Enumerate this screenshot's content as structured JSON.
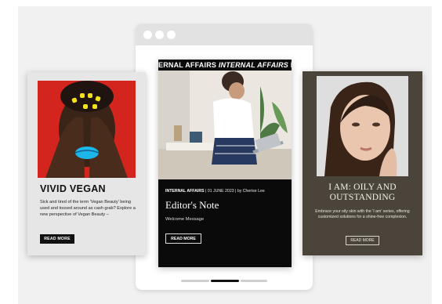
{
  "browser": {
    "window_dots": [
      "window-dot-1",
      "window-dot-2",
      "window-dot-3"
    ]
  },
  "cards": {
    "left": {
      "title": "VIVID VEGAN",
      "description": "Sick and tired of the term 'Vegan Beauty' being used and tossed around as cash grab? Explore a new perspective of Vegan Beauty –",
      "button_label": "READ MORE",
      "accent": "#d3241e"
    },
    "center": {
      "marquee_1": "ERNAL AFFAIRS",
      "marquee_2": "INTERNAL AFFAIRS",
      "marquee_3": "I",
      "category": "INTERNAL AFFAIRS",
      "date": "01 JUNE 2023",
      "author": "by Cherise Lee",
      "separator": "|",
      "title": "Editor's Note",
      "subtitle": "Welcome Message",
      "button_label": "READ MORE"
    },
    "right": {
      "title": "I AM: OILY AND OUTSTANDING",
      "description": "Embrace your oily skin with the 'I am' series, offering customized solutions for a shine-free complexion.",
      "button_label": "READ MORE",
      "background": "#4a443a"
    }
  },
  "pager": {
    "active_index": 1,
    "count": 3
  }
}
